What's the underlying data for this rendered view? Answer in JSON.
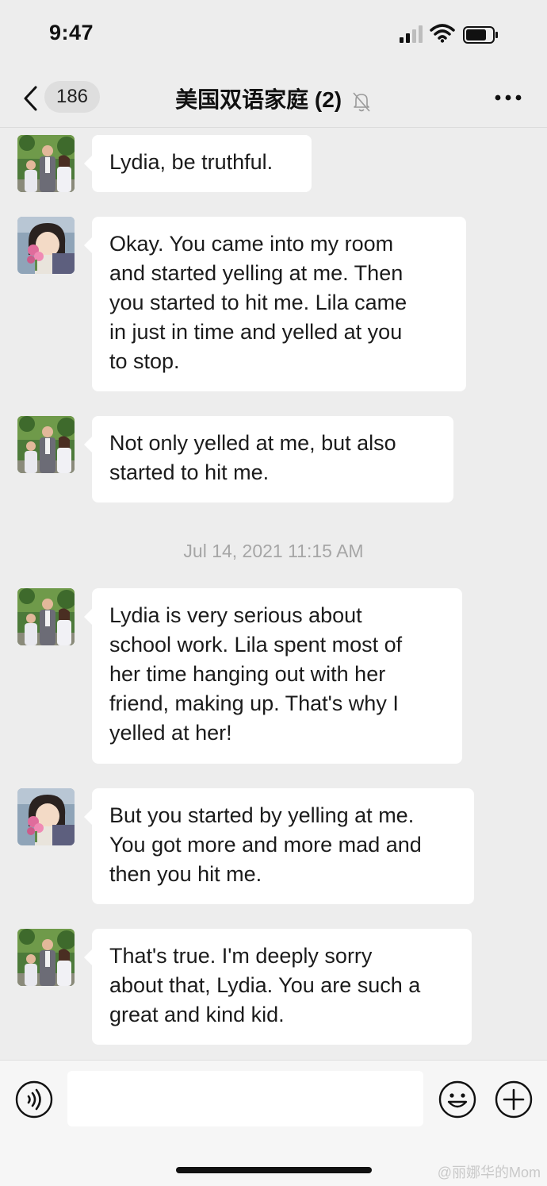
{
  "status_bar": {
    "time": "9:47"
  },
  "nav": {
    "unread_count": "186",
    "title": "美国双语家庭 (2)"
  },
  "messages": [
    {
      "sender_avatar": "family-photo",
      "text": "Lydia, be truthful."
    },
    {
      "sender_avatar": "anime-girl",
      "text": "Okay. You came into my room\nand started yelling at me. Then\nyou started to hit me. Lila came\nin just in time and yelled at you\nto stop."
    },
    {
      "sender_avatar": "family-photo",
      "text": "Not only yelled at me, but also\nstarted to hit me."
    },
    {
      "sender_avatar": "family-photo",
      "text": "Lydia is very serious about\nschool work. Lila spent most of\nher time hanging out with her\nfriend, making up. That's why I\nyelled at her!"
    },
    {
      "sender_avatar": "anime-girl",
      "text": "But you started by yelling at me.\nYou got more and more mad and\nthen you hit me."
    },
    {
      "sender_avatar": "family-photo",
      "text": "That's true. I'm deeply sorry\nabout that, Lydia. You are such a\ngreat and kind kid."
    }
  ],
  "timestamp": "Jul 14, 2021 11:15 AM",
  "input_bar": {
    "message_value": ""
  },
  "watermark": "@丽娜华的Mom",
  "icons": {
    "back": "chevron-left-icon",
    "mute": "bell-off-icon",
    "more": "more-dots-icon",
    "voice": "voice-icon",
    "emoji": "emoji-icon",
    "plus": "plus-icon"
  },
  "colors": {
    "background": "#ededed",
    "bubble": "#ffffff",
    "timestamp": "#a6a6a6"
  }
}
